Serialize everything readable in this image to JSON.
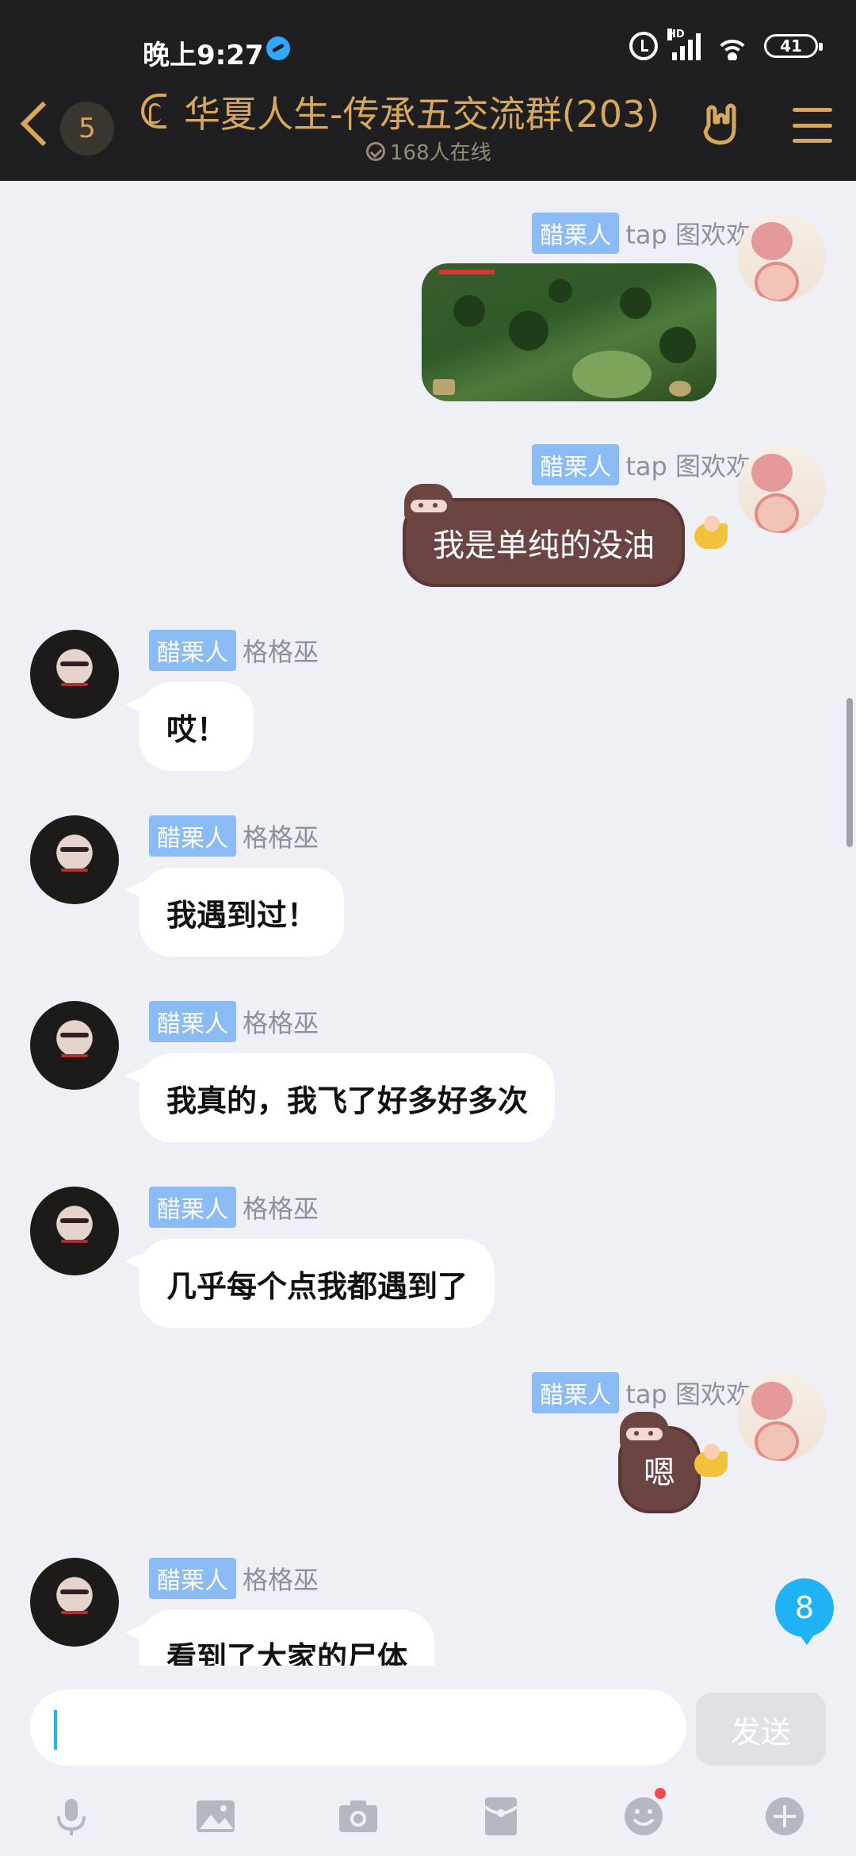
{
  "status_bar": {
    "time": "晚上9:27",
    "battery": "41",
    "network_label": "HD"
  },
  "header": {
    "unread_count": "5",
    "title": "华夏人生-传承五交流群(203)",
    "online": "168人在线"
  },
  "messages": [
    {
      "tag": "醋栗人",
      "nick": "tap 图欢欢",
      "type": "image"
    },
    {
      "tag": "醋栗人",
      "nick": "tap 图欢欢",
      "text": "我是单纯的没油"
    },
    {
      "tag": "醋栗人",
      "nick": "格格巫",
      "text": "哎！"
    },
    {
      "tag": "醋栗人",
      "nick": "格格巫",
      "text": "我遇到过！"
    },
    {
      "tag": "醋栗人",
      "nick": "格格巫",
      "text": "我真的，我飞了好多好多次"
    },
    {
      "tag": "醋栗人",
      "nick": "格格巫",
      "text": "几乎每个点我都遇到了"
    },
    {
      "tag": "醋栗人",
      "nick": "tap 图欢欢",
      "text": "嗯"
    },
    {
      "tag": "醋栗人",
      "nick": "格格巫",
      "text": "看到了大家的尸体"
    }
  ],
  "new_message_count": "8",
  "composer": {
    "input_value": "",
    "send_label": "发送"
  },
  "toolbar": {
    "icons": [
      "microphone-icon",
      "image-icon",
      "camera-icon",
      "red-packet-icon",
      "emoji-icon",
      "plus-icon"
    ]
  },
  "colors": {
    "header_bg": "#1f1f22",
    "accent_gold": "#d8a85a",
    "tag_blue": "#8bbbf5",
    "badge_blue": "#1fb3f5"
  }
}
